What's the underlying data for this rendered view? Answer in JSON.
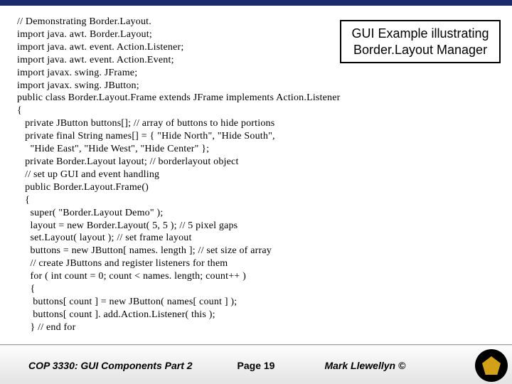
{
  "slide": {
    "title_line1": "GUI Example illustrating",
    "title_line2": "Border.Layout Manager",
    "code": "// Demonstrating Border.Layout.\nimport java. awt. Border.Layout;\nimport java. awt. event. Action.Listener;\nimport java. awt. event. Action.Event;\nimport javax. swing. JFrame;\nimport javax. swing. JButton;\npublic class Border.Layout.Frame extends JFrame implements Action.Listener\n{\n   private JButton buttons[]; // array of buttons to hide portions\n   private final String names[] = { \"Hide North\", \"Hide South\",\n     \"Hide East\", \"Hide West\", \"Hide Center\" };\n   private Border.Layout layout; // borderlayout object\n   // set up GUI and event handling\n   public Border.Layout.Frame()\n   {\n     super( \"Border.Layout Demo\" );\n     layout = new Border.Layout( 5, 5 ); // 5 pixel gaps\n     set.Layout( layout ); // set frame layout\n     buttons = new JButton[ names. length ]; // set size of array\n     // create JButtons and register listeners for them\n     for ( int count = 0; count < names. length; count++ )\n     {\n      buttons[ count ] = new JButton( names[ count ] );\n      buttons[ count ]. add.Action.Listener( this );\n     } // end for"
  },
  "footer": {
    "course": "COP 3330: GUI Components Part 2",
    "page": "Page 19",
    "author": "Mark Llewellyn ©"
  }
}
